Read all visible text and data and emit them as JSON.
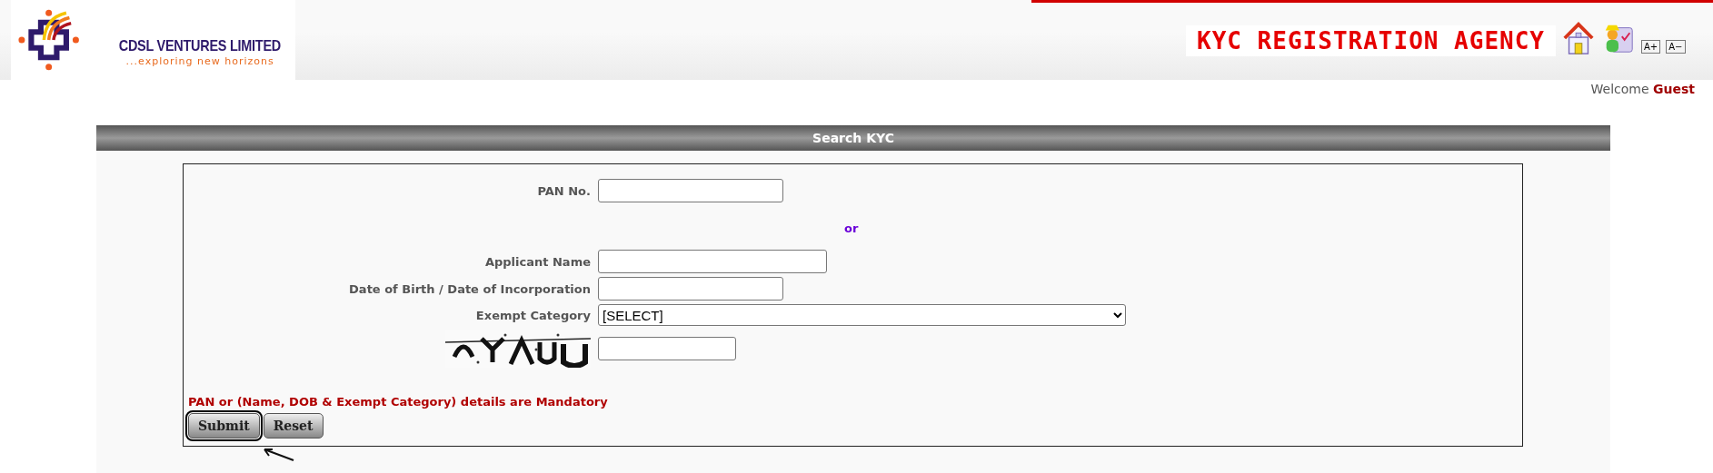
{
  "logo": {
    "name": "CDSL VENTURES LIMITED",
    "tagline": "...exploring new horizons"
  },
  "banner": {
    "title": "KYC REGISTRATION AGENCY"
  },
  "font_buttons": [
    "A+",
    "A−"
  ],
  "welcome": {
    "label": "Welcome",
    "user": "Guest"
  },
  "panel": {
    "title": "Search KYC"
  },
  "form": {
    "fields": [
      {
        "kind": "input",
        "label": "PAN No."
      },
      {
        "kind": "separator",
        "label": "or"
      },
      {
        "kind": "input",
        "label": "Applicant Name"
      },
      {
        "kind": "input",
        "label": "Date of Birth / Date of Incorporation"
      },
      {
        "kind": "select",
        "label": "Exempt Category",
        "value": "[SELECT]"
      },
      {
        "kind": "captcha"
      }
    ],
    "note": "PAN or (Name, DOB & Exempt Category) details are Mandatory",
    "buttons": [
      {
        "label": "Submit",
        "selected": true
      },
      {
        "label": "Reset",
        "selected": false
      }
    ]
  }
}
